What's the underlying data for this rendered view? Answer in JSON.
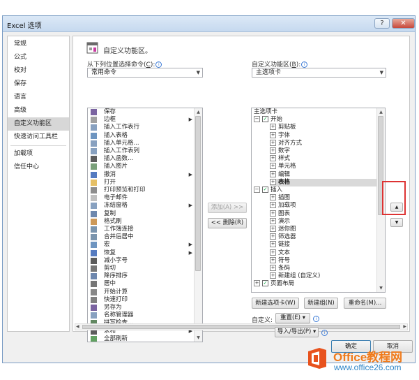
{
  "window": {
    "title": "Excel 选项",
    "help": "?",
    "close": "✕"
  },
  "nav": {
    "group1": [
      "常规",
      "公式",
      "校对",
      "保存",
      "语言",
      "高级",
      "自定义功能区",
      "快速访问工具栏"
    ],
    "group2": [
      "加载项",
      "信任中心"
    ],
    "active": "自定义功能区"
  },
  "header": {
    "title": "自定义功能区。"
  },
  "left": {
    "label": "从下列位置选择命令(",
    "label_key": "C",
    "label_end": "):",
    "combo": "常用命令",
    "commands": [
      {
        "label": "保存",
        "icon": "save-icon",
        "color": "#5a3d8a",
        "sub": false
      },
      {
        "label": "边框",
        "icon": "border-icon",
        "color": "#8a8a8a",
        "sub": true
      },
      {
        "label": "插入工作表行",
        "icon": "insert-rows-icon",
        "color": "#6a8ab0",
        "sub": false
      },
      {
        "label": "插入表格",
        "icon": "insert-table-icon",
        "color": "#4a7ab0",
        "sub": false
      },
      {
        "label": "插入单元格...",
        "icon": "insert-cells-icon",
        "color": "#6a8ab0",
        "sub": false
      },
      {
        "label": "插入工作表列",
        "icon": "insert-columns-icon",
        "color": "#6a8ab0",
        "sub": false
      },
      {
        "label": "插入函数...",
        "icon": "function-icon",
        "color": "#333333",
        "sub": false
      },
      {
        "label": "插入图片",
        "icon": "picture-icon",
        "color": "#5a8a5a",
        "sub": false
      },
      {
        "label": "撤消",
        "icon": "undo-icon",
        "color": "#2a5ab0",
        "sub": true
      },
      {
        "label": "打开",
        "icon": "open-folder-icon",
        "color": "#e0b040",
        "sub": false
      },
      {
        "label": "打印预览和打印",
        "icon": "print-preview-icon",
        "color": "#707070",
        "sub": false
      },
      {
        "label": "电子邮件",
        "icon": "email-icon",
        "color": "#b0b0b0",
        "sub": false
      },
      {
        "label": "冻结窗格",
        "icon": "freeze-panes-icon",
        "color": "#6a8ab0",
        "sub": true
      },
      {
        "label": "复制",
        "icon": "copy-icon",
        "color": "#4a6a9a",
        "sub": false
      },
      {
        "label": "格式刷",
        "icon": "format-painter-icon",
        "color": "#c08030",
        "sub": false
      },
      {
        "label": "工作簿连接",
        "icon": "connections-icon",
        "color": "#5a7a9a",
        "sub": false
      },
      {
        "label": "合并后居中",
        "icon": "merge-center-icon",
        "color": "#5a7a9a",
        "sub": false
      },
      {
        "label": "宏",
        "icon": "macro-icon",
        "color": "#4a7ab0",
        "sub": true
      },
      {
        "label": "恢复",
        "icon": "redo-icon",
        "color": "#2a5ab0",
        "sub": true
      },
      {
        "label": "减小字号",
        "icon": "decrease-font-icon",
        "color": "#333333",
        "sub": false
      },
      {
        "label": "剪切",
        "icon": "cut-icon",
        "color": "#555555",
        "sub": false
      },
      {
        "label": "降序排序",
        "icon": "sort-desc-icon",
        "color": "#4a6a9a",
        "sub": false
      },
      {
        "label": "居中",
        "icon": "center-align-icon",
        "color": "#555555",
        "sub": false
      },
      {
        "label": "开始计算",
        "icon": "calculate-icon",
        "color": "#6a6a6a",
        "sub": false
      },
      {
        "label": "快速打印",
        "icon": "quick-print-icon",
        "color": "#606060",
        "sub": false
      },
      {
        "label": "另存为",
        "icon": "save-as-icon",
        "color": "#5a3d8a",
        "sub": false
      },
      {
        "label": "名称管理器",
        "icon": "name-manager-icon",
        "color": "#6a8ab0",
        "sub": false
      },
      {
        "label": "拼写检查...",
        "icon": "spelling-icon",
        "color": "#3a6a3a",
        "sub": false
      },
      {
        "label": "求和",
        "icon": "sum-icon",
        "color": "#333333",
        "sub": true
      },
      {
        "label": "全部刷新",
        "icon": "refresh-icon",
        "color": "#3a8a3a",
        "sub": false
      }
    ]
  },
  "middle": {
    "add": "添加(A) >>",
    "remove": "<< 删除(R)"
  },
  "right": {
    "label": "自定义功能区(",
    "label_key": "B",
    "label_end": "):",
    "combo": "主选项卡",
    "tree": [
      {
        "label": "主选项卡",
        "level": 0,
        "exp": "",
        "chk": false
      },
      {
        "label": "开始",
        "level": 0,
        "exp": "⊟",
        "chk": true
      },
      {
        "label": "剪贴板",
        "level": 1,
        "exp": "⊞",
        "chk": false
      },
      {
        "label": "字体",
        "level": 1,
        "exp": "⊞",
        "chk": false
      },
      {
        "label": "对齐方式",
        "level": 1,
        "exp": "⊞",
        "chk": false
      },
      {
        "label": "数字",
        "level": 1,
        "exp": "⊞",
        "chk": false
      },
      {
        "label": "样式",
        "level": 1,
        "exp": "⊞",
        "chk": false
      },
      {
        "label": "单元格",
        "level": 1,
        "exp": "⊞",
        "chk": false
      },
      {
        "label": "编辑",
        "level": 1,
        "exp": "⊞",
        "chk": false
      },
      {
        "label": "表格",
        "level": 1,
        "exp": "⊞",
        "chk": false,
        "selected": true
      },
      {
        "label": "插入",
        "level": 0,
        "exp": "⊟",
        "chk": true
      },
      {
        "label": "插图",
        "level": 1,
        "exp": "⊞",
        "chk": false
      },
      {
        "label": "加载项",
        "level": 1,
        "exp": "⊞",
        "chk": false
      },
      {
        "label": "图表",
        "level": 1,
        "exp": "⊞",
        "chk": false
      },
      {
        "label": "演示",
        "level": 1,
        "exp": "⊞",
        "chk": false
      },
      {
        "label": "迷你图",
        "level": 1,
        "exp": "⊞",
        "chk": false
      },
      {
        "label": "筛选器",
        "level": 1,
        "exp": "⊞",
        "chk": false
      },
      {
        "label": "链接",
        "level": 1,
        "exp": "⊞",
        "chk": false
      },
      {
        "label": "文本",
        "level": 1,
        "exp": "⊞",
        "chk": false
      },
      {
        "label": "符号",
        "level": 1,
        "exp": "⊞",
        "chk": false
      },
      {
        "label": "条码",
        "level": 1,
        "exp": "⊞",
        "chk": false
      },
      {
        "label": "新建组 (自定义)",
        "level": 1,
        "exp": "⊞",
        "chk": false
      },
      {
        "label": "页面布局",
        "level": 0,
        "exp": "⊞",
        "chk": true
      }
    ],
    "buttons": {
      "new_tab": "新建选项卡(W)",
      "new_group": "新建组(N)",
      "rename": "重命名(M)..."
    },
    "customize_label": "自定义:",
    "reset": "重置(E) ▾",
    "import_export": "导入/导出(P) ▾"
  },
  "move": {
    "up": "▲",
    "down": "▼"
  },
  "footer": {
    "ok": "确定",
    "cancel": "取消"
  },
  "watermark": {
    "brand": "Office教程网",
    "url": "www.office26.com"
  }
}
